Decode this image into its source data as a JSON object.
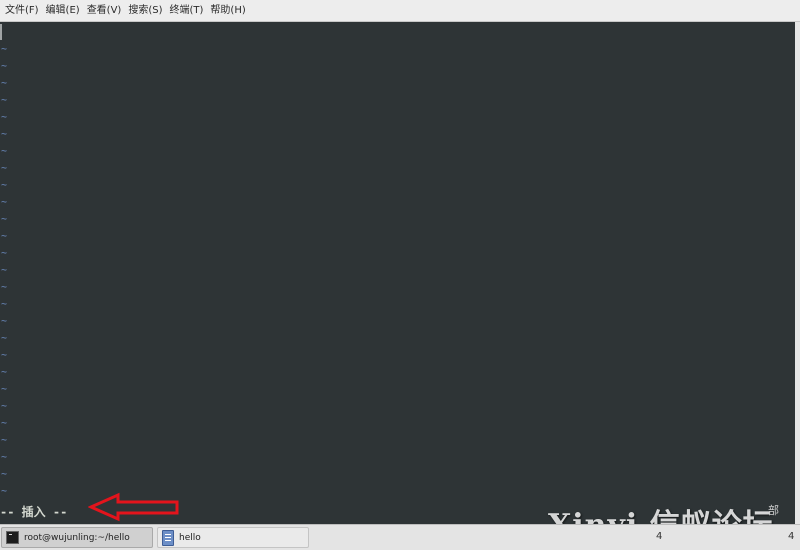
{
  "menubar": {
    "items": [
      {
        "label": "文件(F)"
      },
      {
        "label": "编辑(E)"
      },
      {
        "label": "查看(V)"
      },
      {
        "label": "搜索(S)"
      },
      {
        "label": "终端(T)"
      },
      {
        "label": "帮助(H)"
      }
    ]
  },
  "terminal": {
    "tilde_char": "~",
    "tilde_count": 27,
    "mode_line": "-- 插入 --"
  },
  "annotation": {
    "arrow_color": "#e3141c"
  },
  "watermark": {
    "text": "Xinyi 信蚁论坛",
    "corner_text": "部"
  },
  "taskbar": {
    "tasks": [
      {
        "label": "root@wujunling:~/hello",
        "icon": "terminal-icon"
      },
      {
        "label": "hello",
        "icon": "file-icon"
      }
    ],
    "tray_left": "4",
    "tray_right": "4"
  },
  "colors": {
    "terminal_bg": "#2e3436",
    "tilde": "#6d8ec4",
    "mode_text": "#d3d7cf",
    "menubar_bg": "#ededed"
  }
}
